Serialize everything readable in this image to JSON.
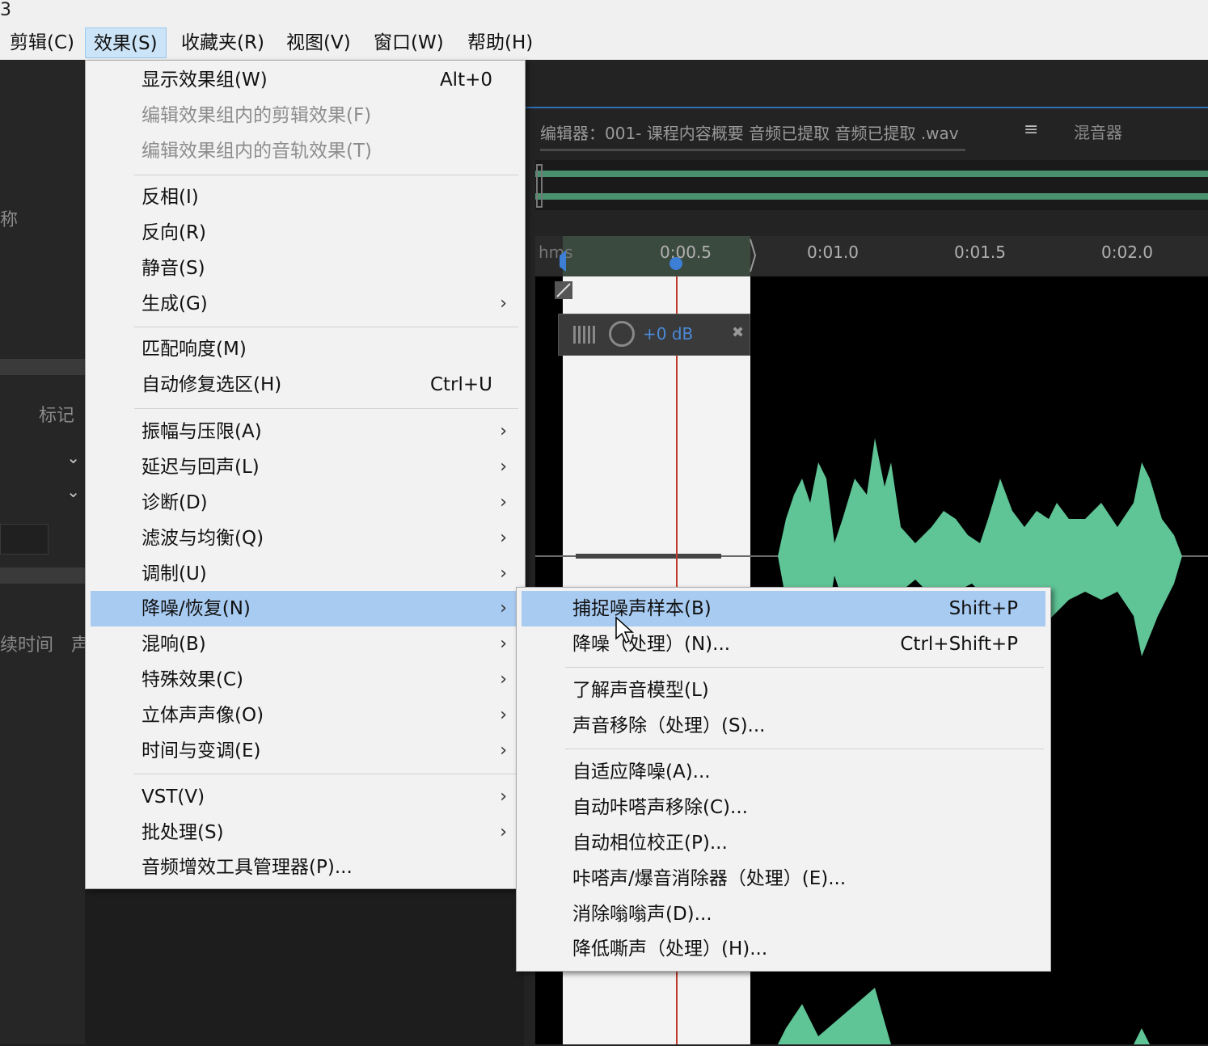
{
  "menubar": {
    "app_glyph": "3",
    "items": [
      {
        "label": "剪辑(C)"
      },
      {
        "label": "效果(S)"
      },
      {
        "label": "收藏夹(R)"
      },
      {
        "label": "视图(V)"
      },
      {
        "label": "窗口(W)"
      },
      {
        "label": "帮助(H)"
      }
    ],
    "active_index": 1
  },
  "left_panel": {
    "name_label": "称",
    "marker_label": "标记",
    "duration_label": "续时间",
    "extra_label": "声"
  },
  "editor": {
    "tab_title": "编辑器：001- 课程内容概要 音频已提取 音频已提取 .wav",
    "menu_icon": "≡",
    "mixer_tab": "混音器",
    "ruler": {
      "unit": "hms",
      "ticks": [
        "0:00.5",
        "0:01.0",
        "0:01.5",
        "0:02.0"
      ]
    },
    "hud": {
      "gain": "+0 dB"
    },
    "waveform_color": "#5fc496"
  },
  "effects_menu": {
    "items": [
      {
        "label": "显示效果组(W)",
        "shortcut": "Alt+0"
      },
      {
        "label": "编辑效果组内的剪辑效果(F)",
        "disabled": true
      },
      {
        "label": "编辑效果组内的音轨效果(T)",
        "disabled": true
      },
      {
        "label": "反相(I)"
      },
      {
        "label": "反向(R)"
      },
      {
        "label": "静音(S)"
      },
      {
        "label": "生成(G)",
        "submenu": true
      },
      {
        "label": "匹配响度(M)"
      },
      {
        "label": "自动修复选区(H)",
        "shortcut": "Ctrl+U"
      },
      {
        "label": "振幅与压限(A)",
        "submenu": true
      },
      {
        "label": "延迟与回声(L)",
        "submenu": true
      },
      {
        "label": "诊断(D)",
        "submenu": true
      },
      {
        "label": "滤波与均衡(Q)",
        "submenu": true
      },
      {
        "label": "调制(U)",
        "submenu": true
      },
      {
        "label": "降噪/恢复(N)",
        "submenu": true,
        "highlight": true
      },
      {
        "label": "混响(B)",
        "submenu": true
      },
      {
        "label": "特殊效果(C)",
        "submenu": true
      },
      {
        "label": "立体声声像(O)",
        "submenu": true
      },
      {
        "label": "时间与变调(E)",
        "submenu": true
      },
      {
        "label": "VST(V)",
        "submenu": true
      },
      {
        "label": "批处理(S)",
        "submenu": true
      },
      {
        "label": "音频增效工具管理器(P)..."
      }
    ],
    "submenu_arrow": "›"
  },
  "noise_menu": {
    "items": [
      {
        "label": "捕捉噪声样本(B)",
        "shortcut": "Shift+P",
        "highlight": true
      },
      {
        "label": "降噪（处理）(N)...",
        "shortcut": "Ctrl+Shift+P"
      },
      {
        "label": "了解声音模型(L)"
      },
      {
        "label": "声音移除（处理）(S)..."
      },
      {
        "label": "自适应降噪(A)..."
      },
      {
        "label": "自动咔嗒声移除(C)..."
      },
      {
        "label": "自动相位校正(P)..."
      },
      {
        "label": "咔嗒声/爆音消除器（处理）(E)..."
      },
      {
        "label": "消除嗡嗡声(D)..."
      },
      {
        "label": "降低嘶声（处理）(H)..."
      }
    ]
  }
}
